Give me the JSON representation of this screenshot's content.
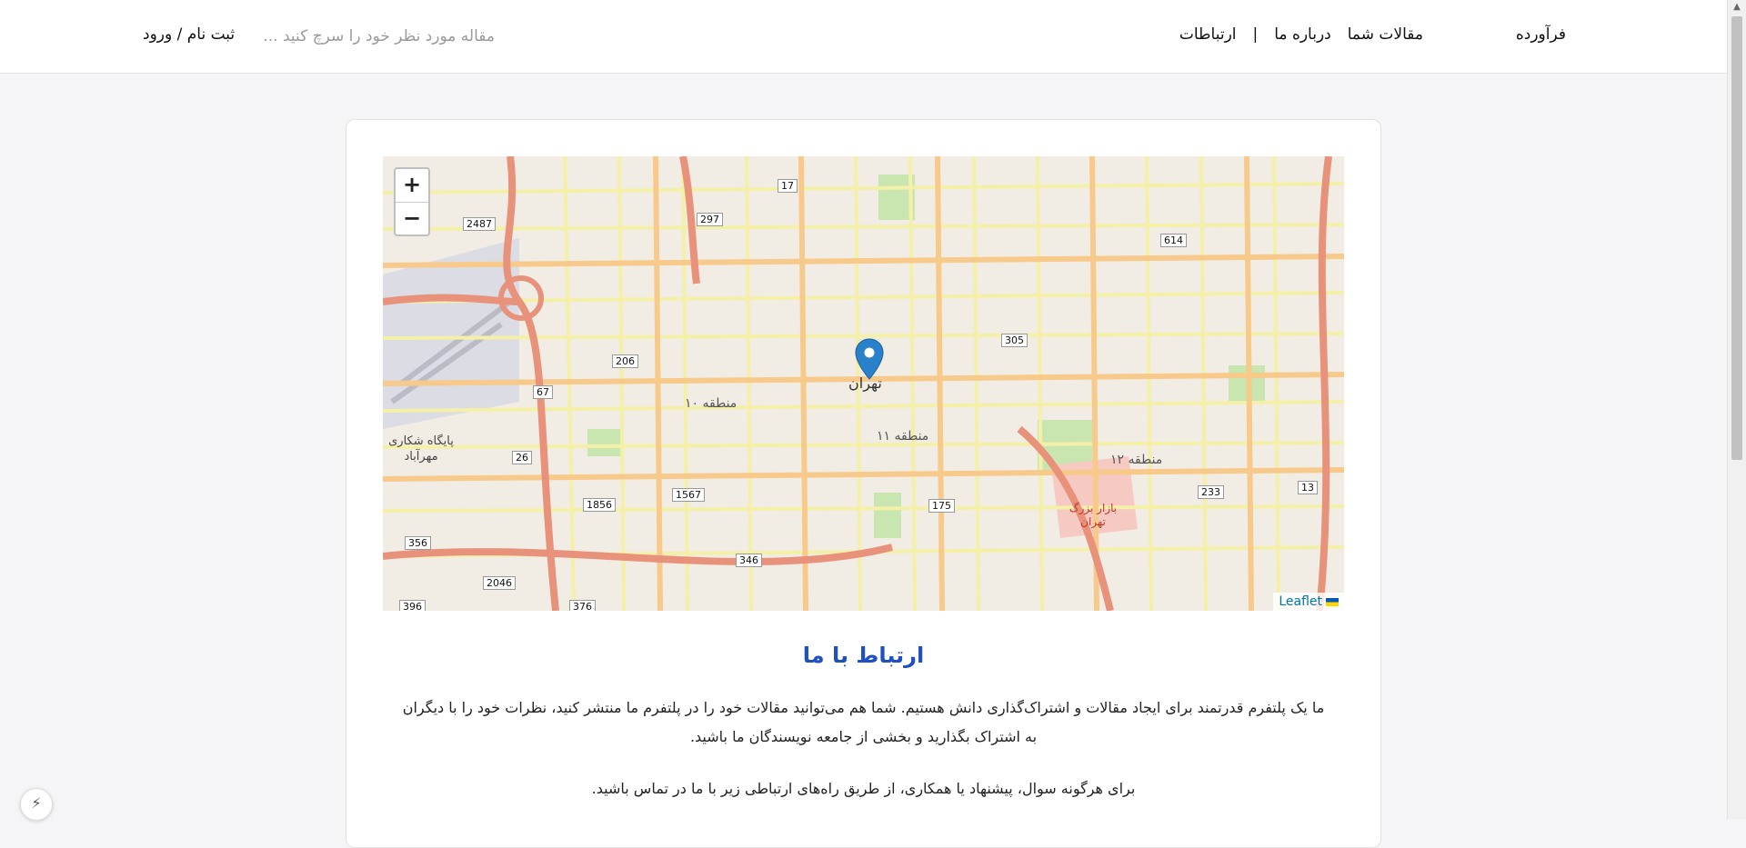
{
  "header": {
    "brand": "فرآورده",
    "nav": [
      "مقالات شما",
      "درباره ما",
      "|",
      "ارتباطات"
    ],
    "search_placeholder": "مقاله مورد نظر خود را سرچ کنید ...",
    "auth": "ثبت نام / ورود"
  },
  "map": {
    "zoom_in": "+",
    "zoom_out": "−",
    "attribution": "Leaflet",
    "city_label": "تهران",
    "labels": {
      "region10": "منطقه ۱۰",
      "region11": "منطقه ۱۱",
      "region12": "منطقه ۱۲",
      "airbase": "پایگاه شکاری مهرآباد",
      "bazaar": "بازار بزرگ تهران"
    },
    "road_numbers": [
      "17",
      "297",
      "2487",
      "614",
      "305",
      "206",
      "67",
      "26",
      "1856",
      "1567",
      "175",
      "233",
      "13",
      "356",
      "346",
      "2046",
      "396",
      "376"
    ]
  },
  "content": {
    "title": "ارتباط با ما",
    "paragraph": "ما یک پلتفرم قدرتمند برای ایجاد مقالات و اشتراک‌گذاری دانش هستیم. شما هم می‌توانید مقالات خود را در پلتفرم ما منتشر کنید، نظرات خود را با دیگران به اشتراک بگذارید و بخشی از جامعه نویسندگان ما باشید.",
    "paragraph2": "برای هرگونه سوال، پیشنهاد یا همکاری، از طریق راه‌های ارتباطی زیر با ما در تماس باشید."
  },
  "colors": {
    "title": "#1e4fc3",
    "marker": "#2a81cb",
    "road_major": "#e8927c",
    "road_secondary": "#f7c98a",
    "road_minor": "#f4f0a8"
  }
}
